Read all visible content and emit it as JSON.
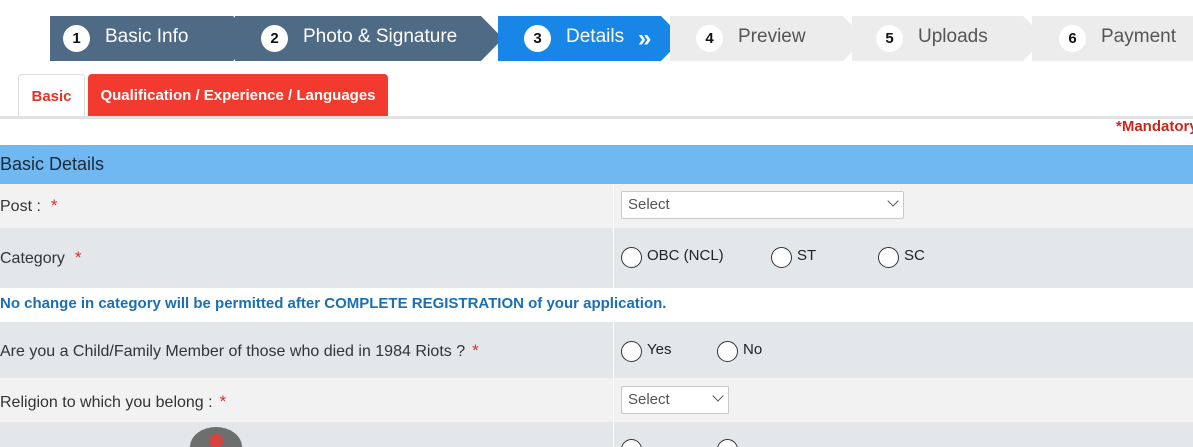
{
  "stepper": {
    "steps": [
      {
        "num": "1",
        "label": "Basic Info",
        "state": "done"
      },
      {
        "num": "2",
        "label": "Photo & Signature",
        "state": "done"
      },
      {
        "num": "3",
        "label": "Details",
        "state": "active"
      },
      {
        "num": "4",
        "label": "Preview",
        "state": "todo"
      },
      {
        "num": "5",
        "label": "Uploads",
        "state": "todo"
      },
      {
        "num": "6",
        "label": "Payment",
        "state": "todo"
      }
    ],
    "active_chevron": "»"
  },
  "tabs": {
    "basic": "Basic",
    "qualification": "Qualification / Experience / Languages"
  },
  "mandatory_note": "*Mandatory",
  "section": {
    "title": "Basic Details"
  },
  "form": {
    "post": {
      "label": "Post :",
      "required": "*",
      "value": "Select"
    },
    "category": {
      "label": "Category",
      "required": "*",
      "options": [
        "OBC (NCL)",
        "ST",
        "SC"
      ]
    },
    "category_note": "No change in category will be permitted after COMPLETE REGISTRATION of your application.",
    "riots": {
      "label": "Are you a Child/Family Member of those who died in 1984 Riots ?",
      "required": "*",
      "options": [
        "Yes",
        "No"
      ]
    },
    "religion": {
      "label": "Religion to which you belong :",
      "required": "*",
      "value": "Select"
    }
  },
  "colors": {
    "step_done": "#4f6a85",
    "step_active": "#1786e6",
    "step_todo": "#ececec",
    "tab_active_text": "#e1342a",
    "tab_red": "#f23a2e",
    "section_header": "#6fb8f1",
    "required_star": "#d3302a",
    "note_blue": "#1b6fb3"
  }
}
